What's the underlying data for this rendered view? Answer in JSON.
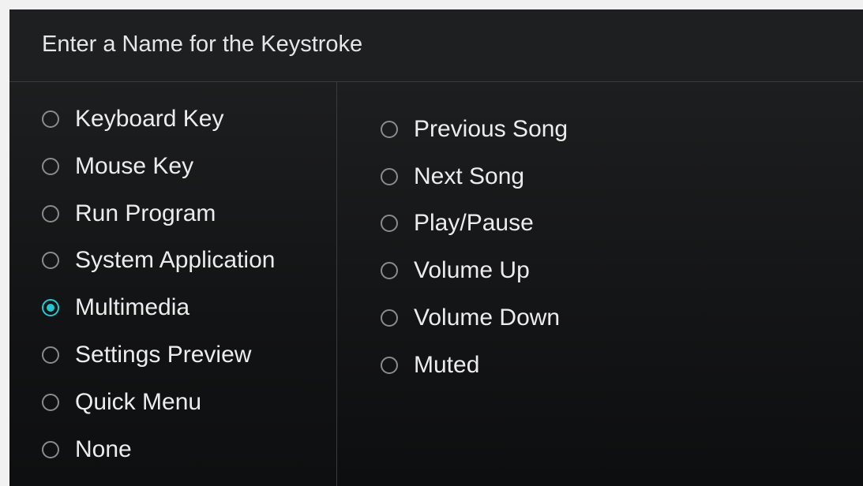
{
  "dialog": {
    "title": "Enter a Name for the Keystroke"
  },
  "key_types": {
    "items": [
      {
        "label": "Keyboard Key",
        "checked": false
      },
      {
        "label": "Mouse Key",
        "checked": false
      },
      {
        "label": "Run Program",
        "checked": false
      },
      {
        "label": "System Application",
        "checked": false
      },
      {
        "label": "Multimedia",
        "checked": true
      },
      {
        "label": "Settings Preview",
        "checked": false
      },
      {
        "label": "Quick Menu",
        "checked": false
      },
      {
        "label": "None",
        "checked": false
      }
    ]
  },
  "multimedia": {
    "items": [
      {
        "label": "Previous Song",
        "checked": false
      },
      {
        "label": "Next Song",
        "checked": false
      },
      {
        "label": "Play/Pause",
        "checked": false
      },
      {
        "label": "Volume Up",
        "checked": false
      },
      {
        "label": "Volume Down",
        "checked": false
      },
      {
        "label": "Muted",
        "checked": false
      }
    ]
  },
  "colors": {
    "accent": "#21c8cf",
    "background": "#151617",
    "text": "#ececec"
  }
}
